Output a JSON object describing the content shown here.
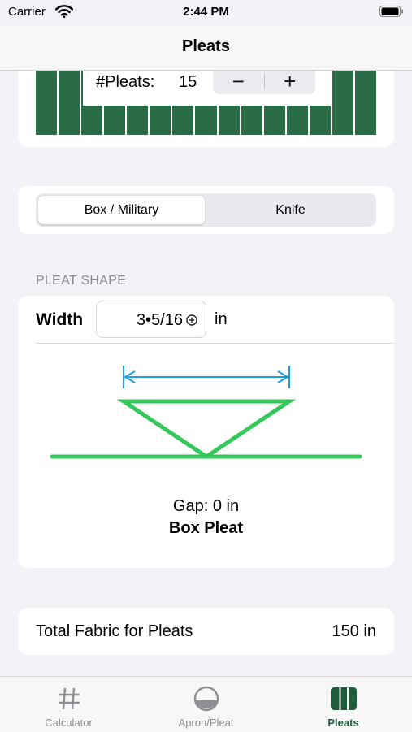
{
  "status": {
    "carrier": "Carrier",
    "time": "2:44 PM"
  },
  "nav": {
    "title": "Pleats"
  },
  "preview": {
    "pleats_label": "#Pleats:",
    "pleats_count": "15",
    "minus": "−",
    "plus": "+",
    "bar_color": "#2a6c45"
  },
  "style_picker": {
    "options": [
      "Box / Military",
      "Knife"
    ],
    "selected": "Box / Military"
  },
  "pleat_shape": {
    "section_header": "PLEAT SHAPE",
    "width_label": "Width",
    "width_value": "3•5/16",
    "width_unit": "in",
    "gap_text": "Gap: 0 in",
    "pleat_name": "Box Pleat",
    "diagram_color": "#34c759",
    "arrow_color": "#1a9fe0"
  },
  "total": {
    "label": "Total Fabric for Pleats",
    "value": "150 in"
  },
  "tabs": [
    {
      "label": "Calculator",
      "icon": "hash-icon",
      "active": false
    },
    {
      "label": "Apron/Pleat",
      "icon": "half-circle-icon",
      "active": false
    },
    {
      "label": "Pleats",
      "icon": "pleats-icon",
      "active": true
    }
  ],
  "colors": {
    "accent": "#1f5d3b",
    "background": "#f2f2f7"
  }
}
